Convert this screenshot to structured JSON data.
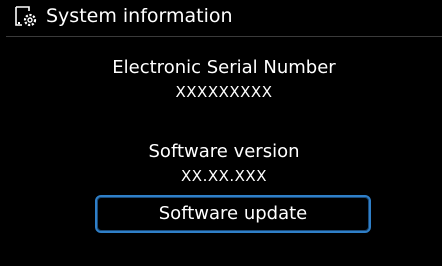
{
  "header": {
    "title": "System information",
    "icon": "system-settings-icon"
  },
  "esn": {
    "label": "Electronic Serial Number",
    "value": "XXXXXXXXX"
  },
  "software": {
    "label": "Software version",
    "value": "XX.XX.XXX"
  },
  "actions": {
    "update_label": "Software update"
  },
  "colors": {
    "background": "#000000",
    "text": "#ffffff",
    "button_border": "#2f7fc8"
  }
}
